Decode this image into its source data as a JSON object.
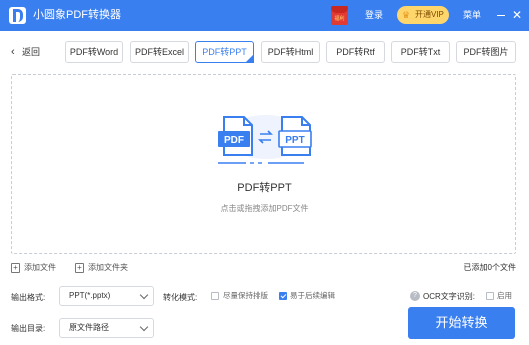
{
  "titlebar": {
    "app_title": "小圆象PDF转换器",
    "redpacket_label": "福利",
    "login": "登录",
    "vip_label": "开通VIP",
    "menu": "菜单",
    "close_glyph": "✕",
    "accent_color": "#3a7ff0"
  },
  "toolbar": {
    "back_label": "返回",
    "back_glyph": "‹",
    "tabs": [
      {
        "label": "PDF转Word"
      },
      {
        "label": "PDF转Excel"
      },
      {
        "label": "PDF转PPT",
        "active": true
      },
      {
        "label": "PDF转Html"
      },
      {
        "label": "PDF转Rtf"
      },
      {
        "label": "PDF转Txt"
      },
      {
        "label": "PDF转图片"
      }
    ]
  },
  "dropzone": {
    "icon_left_text": "PDF",
    "icon_right_text": "PPT",
    "title": "PDF转PPT",
    "subtitle": "点击或拖拽添加PDF文件"
  },
  "file_actions": {
    "add_file": "添加文件",
    "add_folder": "添加文件夹",
    "added_count": "已添加0个文件"
  },
  "settings": {
    "output_format_label": "输出格式:",
    "output_format_value": "PPT(*.pptx)",
    "convert_mode_label": "转化模式:",
    "mode_keep_layout": "尽量保持排版",
    "mode_keep_layout_checked": false,
    "mode_easy_edit": "易于后续编辑",
    "mode_easy_edit_checked": true,
    "ocr_label": "OCR文字识别:",
    "ocr_enable": "启用",
    "ocr_checked": false,
    "output_dir_label": "输出目录:",
    "output_dir_value": "原文件路径",
    "start_button": "开始转换"
  }
}
